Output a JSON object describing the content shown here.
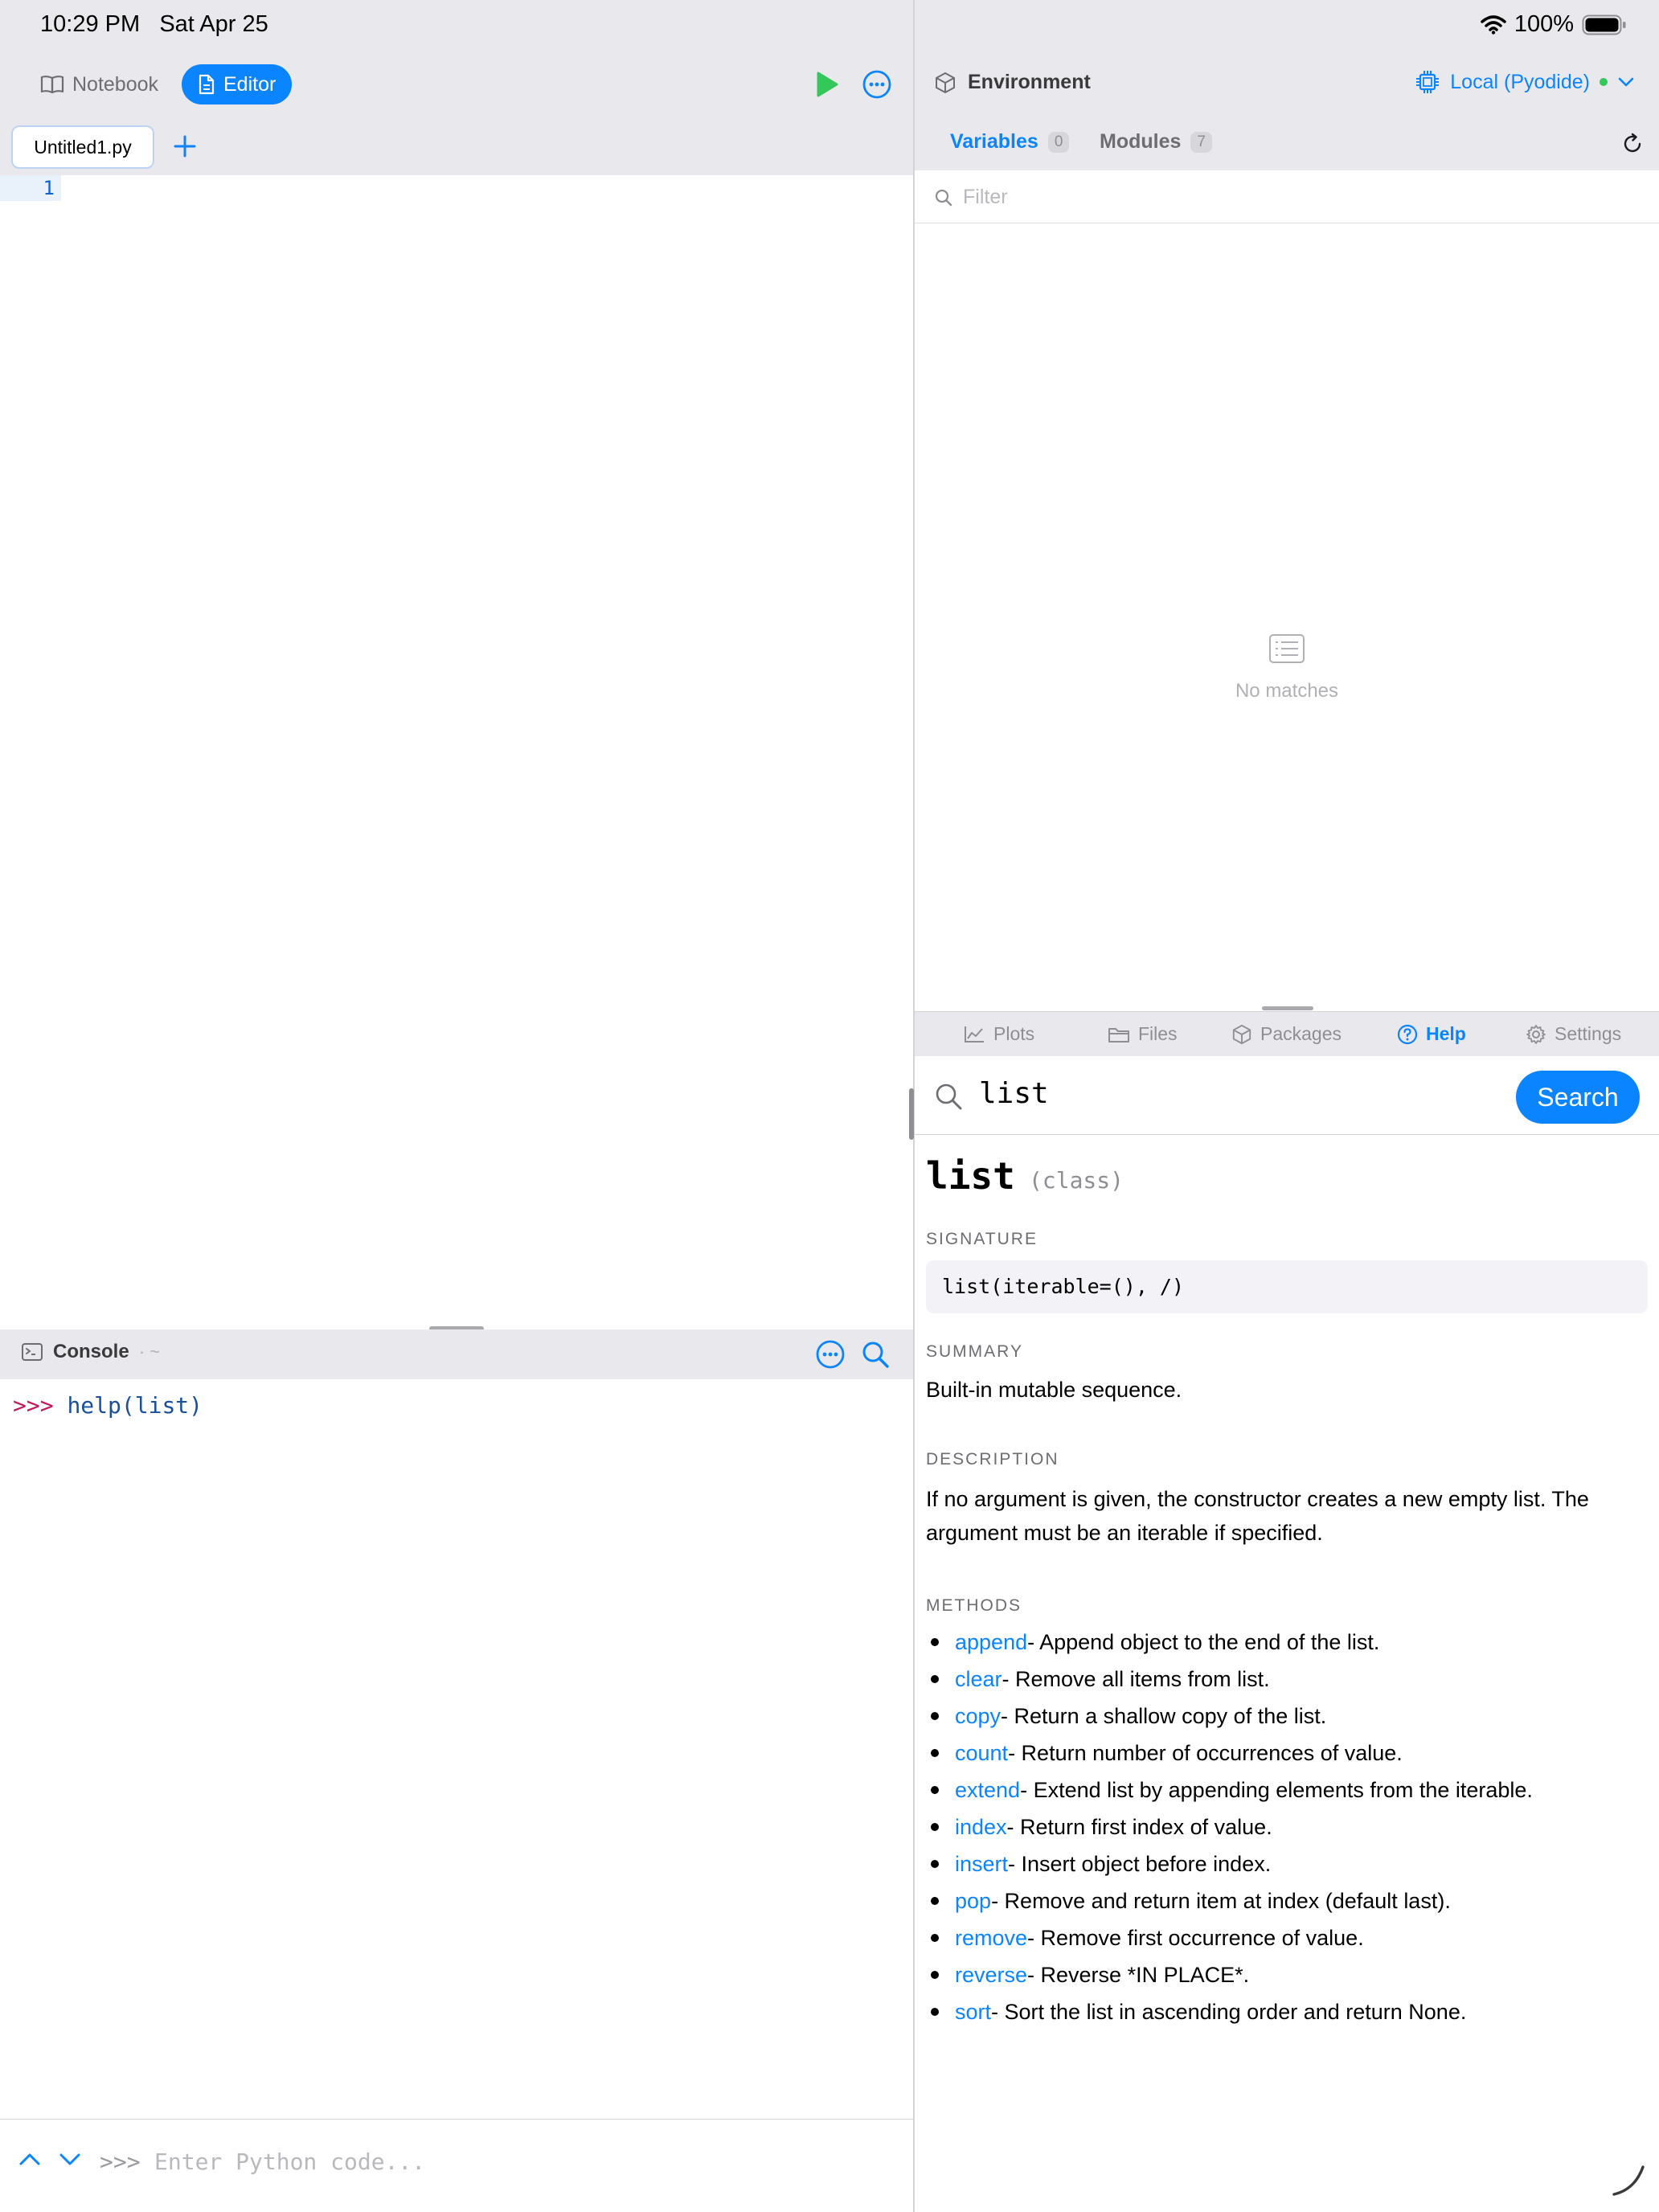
{
  "status_bar": {
    "time": "10:29 PM",
    "date": "Sat Apr 25",
    "battery": "100%"
  },
  "left_toolbar": {
    "notebook_label": "Notebook",
    "editor_label": "Editor"
  },
  "tabs": {
    "file_name": "Untitled1.py"
  },
  "editor": {
    "line_numbers": [
      "1"
    ]
  },
  "console": {
    "title": "Console",
    "separator": "·",
    "directory": "~",
    "prompt": ">>>",
    "last_command": "help(list)",
    "input_prompt": ">>>",
    "input_placeholder": "Enter Python code..."
  },
  "environment": {
    "title": "Environment",
    "kernel_label": "Local (Pyodide)",
    "kernel_status_color": "#34c759",
    "tabs": [
      {
        "label": "Variables",
        "count": "0"
      },
      {
        "label": "Modules",
        "count": "7"
      }
    ],
    "filter_placeholder": "Filter",
    "empty_text": "No matches"
  },
  "bottom_tabs": [
    {
      "label": "Plots",
      "icon": "chart-icon"
    },
    {
      "label": "Files",
      "icon": "folder-icon"
    },
    {
      "label": "Packages",
      "icon": "package-icon"
    },
    {
      "label": "Help",
      "icon": "help-icon",
      "active": true
    },
    {
      "label": "Settings",
      "icon": "gear-icon"
    }
  ],
  "help": {
    "query": "list",
    "search_button": "Search",
    "name": "list",
    "kind": "(class)",
    "signature_label": "SIGNATURE",
    "signature": "list(iterable=(), /)",
    "summary_label": "SUMMARY",
    "summary": "Built-in mutable sequence.",
    "description_label": "DESCRIPTION",
    "description": "If no argument is given, the constructor creates a new empty list. The argument must be an iterable if specified.",
    "methods_label": "METHODS",
    "methods": [
      {
        "name": "append",
        "desc": " - Append object to the end of the list."
      },
      {
        "name": "clear",
        "desc": " - Remove all items from list."
      },
      {
        "name": "copy",
        "desc": " - Return a shallow copy of the list."
      },
      {
        "name": "count",
        "desc": " - Return number of occurrences of value."
      },
      {
        "name": "extend",
        "desc": " - Extend list by appending elements from the iterable."
      },
      {
        "name": "index",
        "desc": " - Return first index of value."
      },
      {
        "name": "insert",
        "desc": " - Insert object before index."
      },
      {
        "name": "pop",
        "desc": " - Remove and return item at index (default last)."
      },
      {
        "name": "remove",
        "desc": " - Remove first occurrence of value."
      },
      {
        "name": "reverse",
        "desc": " - Reverse *IN PLACE*."
      },
      {
        "name": "sort",
        "desc": " - Sort the list in ascending order and return None."
      }
    ]
  },
  "colors": {
    "accent": "#0a84ff",
    "run": "#34c759",
    "console_prompt": "#c2185b",
    "console_code": "#1a4f9c"
  }
}
